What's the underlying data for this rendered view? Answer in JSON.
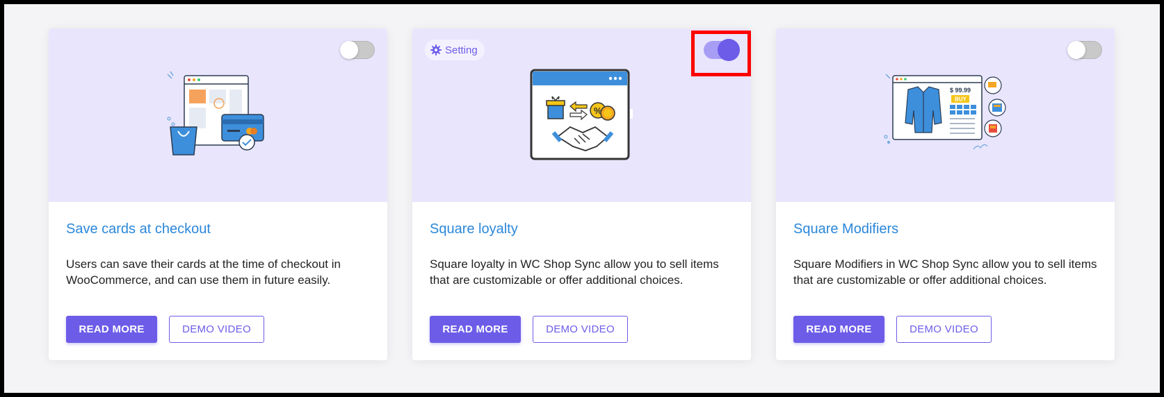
{
  "cards": [
    {
      "title": "Save cards at checkout",
      "description": "Users can save their cards at the time of checkout in WooCommerce, and can use them in future easily.",
      "read_more": "READ MORE",
      "demo_video": "DEMO VIDEO",
      "toggle": "off",
      "illustration": "shopping-bag-credit-card-illustration"
    },
    {
      "title": "Square loyalty",
      "description": "Square loyalty in WC Shop Sync allow you to sell items that are customizable or offer additional choices.",
      "read_more": "READ MORE",
      "demo_video": "DEMO VIDEO",
      "toggle": "on",
      "setting_label": "Setting",
      "illustration": "loyalty-handshake-illustration"
    },
    {
      "title": "Square Modifiers",
      "description": "Square Modifiers in WC Shop Sync allow you to sell items that are customizable or offer additional choices.",
      "read_more": "READ MORE",
      "demo_video": "DEMO VIDEO",
      "toggle": "off",
      "illustration": "product-jacket-modifiers-illustration",
      "price": "$ 99.99",
      "buy": "BUY"
    }
  ],
  "colors": {
    "accent": "#6c5ce7",
    "banner": "#e9e5fd",
    "title": "#2b87da",
    "highlight": "#ff0000"
  }
}
